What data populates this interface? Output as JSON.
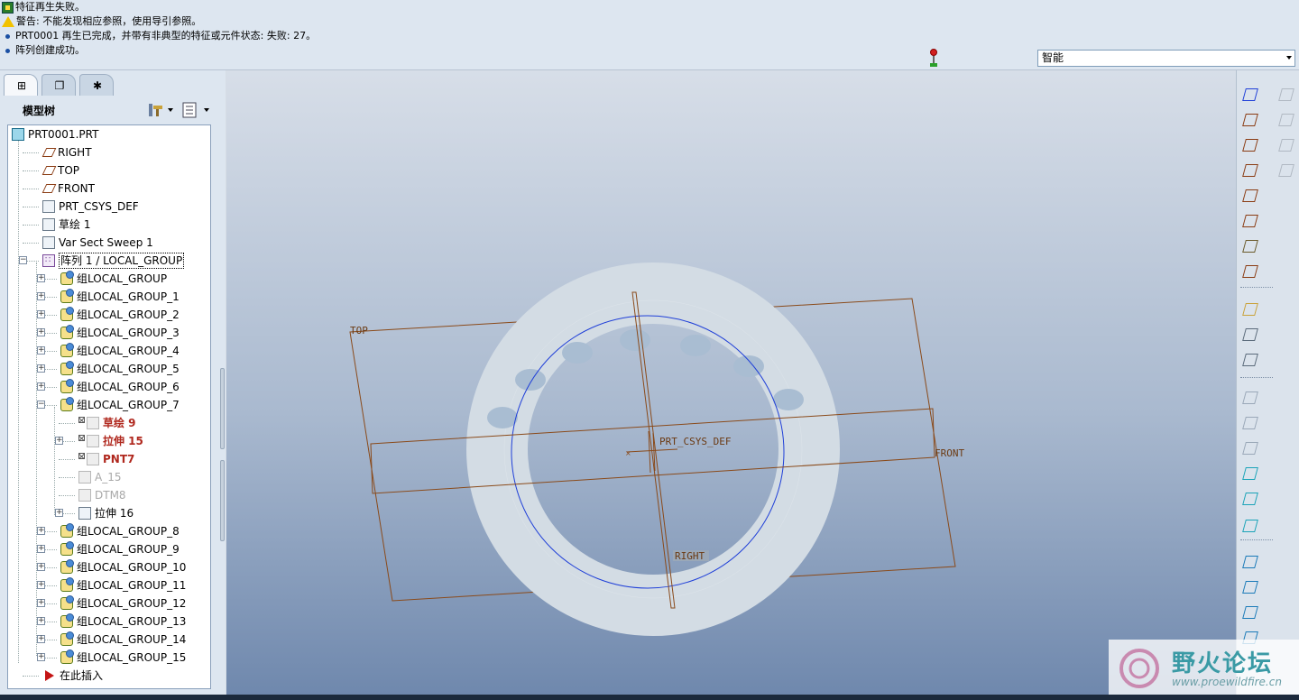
{
  "messages": [
    {
      "icon": "regen-fail-icon",
      "text": "特征再生失败。"
    },
    {
      "icon": "warning-icon",
      "text": "警告: 不能发现相应参照，使用导引参照。"
    },
    {
      "icon": "bullet-icon",
      "text": "PRT0001 再生已完成，并带有非典型的特征或元件状态: 失败: 27。"
    },
    {
      "icon": "bullet-icon",
      "text": "阵列创建成功。"
    }
  ],
  "filter": {
    "selected": "智能"
  },
  "navigator": {
    "tabs": [
      "model-tree-tab",
      "folder-browser-tab",
      "favorites-tab"
    ],
    "title": "模型树"
  },
  "tree": [
    {
      "label": "PRT0001.PRT",
      "icon": "part-icon",
      "level": 0,
      "state": "normal"
    },
    {
      "label": "RIGHT",
      "icon": "datum-plane-icon",
      "level": 1,
      "state": "normal"
    },
    {
      "label": "TOP",
      "icon": "datum-plane-icon",
      "level": 1,
      "state": "normal"
    },
    {
      "label": "FRONT",
      "icon": "datum-plane-icon",
      "level": 1,
      "state": "normal"
    },
    {
      "label": "PRT_CSYS_DEF",
      "icon": "csys-icon",
      "level": 1,
      "state": "normal"
    },
    {
      "label": "草绘 1",
      "icon": "sketch-icon",
      "level": 1,
      "state": "normal"
    },
    {
      "label": "Var Sect Sweep 1",
      "icon": "sweep-icon",
      "level": 1,
      "state": "normal"
    },
    {
      "label": "阵列 1 / LOCAL_GROUP",
      "icon": "pattern-icon",
      "level": 1,
      "state": "selected",
      "expander": "minus"
    },
    {
      "label": "组LOCAL_GROUP",
      "icon": "group-icon",
      "level": 2,
      "state": "normal",
      "expander": "plus"
    },
    {
      "label": "组LOCAL_GROUP_1",
      "icon": "group-icon",
      "level": 2,
      "state": "normal",
      "expander": "plus"
    },
    {
      "label": "组LOCAL_GROUP_2",
      "icon": "group-icon",
      "level": 2,
      "state": "normal",
      "expander": "plus"
    },
    {
      "label": "组LOCAL_GROUP_3",
      "icon": "group-icon",
      "level": 2,
      "state": "normal",
      "expander": "plus"
    },
    {
      "label": "组LOCAL_GROUP_4",
      "icon": "group-icon",
      "level": 2,
      "state": "normal",
      "expander": "plus"
    },
    {
      "label": "组LOCAL_GROUP_5",
      "icon": "group-icon",
      "level": 2,
      "state": "normal",
      "expander": "plus"
    },
    {
      "label": "组LOCAL_GROUP_6",
      "icon": "group-icon",
      "level": 2,
      "state": "normal",
      "expander": "plus"
    },
    {
      "label": "组LOCAL_GROUP_7",
      "icon": "group-icon",
      "level": 2,
      "state": "normal",
      "expander": "minus"
    },
    {
      "label": "草绘 9",
      "icon": "sketch-icon",
      "level": 3,
      "state": "failed"
    },
    {
      "label": "拉伸 15",
      "icon": "extrude-icon",
      "level": 3,
      "state": "failed",
      "expander": "plus"
    },
    {
      "label": "PNT7",
      "icon": "point-icon",
      "level": 3,
      "state": "failed"
    },
    {
      "label": "A_15",
      "icon": "axis-icon",
      "level": 3,
      "state": "dim"
    },
    {
      "label": "DTM8",
      "icon": "datum-plane-icon",
      "level": 3,
      "state": "dim"
    },
    {
      "label": "拉伸 16",
      "icon": "extrude-icon",
      "level": 3,
      "state": "normal",
      "expander": "plus"
    },
    {
      "label": "组LOCAL_GROUP_8",
      "icon": "group-icon",
      "level": 2,
      "state": "normal",
      "expander": "plus"
    },
    {
      "label": "组LOCAL_GROUP_9",
      "icon": "group-icon",
      "level": 2,
      "state": "normal",
      "expander": "plus"
    },
    {
      "label": "组LOCAL_GROUP_10",
      "icon": "group-icon",
      "level": 2,
      "state": "normal",
      "expander": "plus"
    },
    {
      "label": "组LOCAL_GROUP_11",
      "icon": "group-icon",
      "level": 2,
      "state": "normal",
      "expander": "plus"
    },
    {
      "label": "组LOCAL_GROUP_12",
      "icon": "group-icon",
      "level": 2,
      "state": "normal",
      "expander": "plus"
    },
    {
      "label": "组LOCAL_GROUP_13",
      "icon": "group-icon",
      "level": 2,
      "state": "normal",
      "expander": "plus"
    },
    {
      "label": "组LOCAL_GROUP_14",
      "icon": "group-icon",
      "level": 2,
      "state": "normal",
      "expander": "plus"
    },
    {
      "label": "组LOCAL_GROUP_15",
      "icon": "group-icon",
      "level": 2,
      "state": "normal",
      "expander": "plus"
    },
    {
      "label": "在此插入",
      "icon": "insert-here-icon",
      "level": 1,
      "state": "normal"
    }
  ],
  "graphics": {
    "datum_labels": {
      "top": "TOP",
      "front": "FRONT",
      "right": "RIGHT",
      "csys": "PRT_CSYS_DEF"
    },
    "colors": {
      "datum": "#8a4a1a",
      "ring": "#d3dce4",
      "sketch": "#1f3fd8",
      "hole": "#a9bdd2"
    }
  },
  "right_toolbar": [
    "sketch-tool-icon",
    "datum-plane-tool-icon",
    "datum-axis-tool-icon",
    "datum-curve-tool-icon",
    "datum-point-tool-icon",
    "csys-tool-icon",
    "analysis-datum-icon",
    "offset-point-icon",
    "sketch-region-icon",
    "datum-graph-icon",
    "copy-sketch-icon",
    "hole-tool-icon",
    "shell-tool-icon",
    "rib-tool-icon",
    "draft-tool-icon",
    "round-tool-icon",
    "chamfer-tool-icon",
    "extrude-tool-icon",
    "revolve-tool-icon",
    "sweep-tool-icon",
    "blend-tool-icon",
    "mirror-tool-icon",
    "pattern-tool-icon",
    "trim-tool-icon",
    "merge-tool-icon"
  ],
  "watermark": {
    "title": "野火论坛",
    "url": "www.proewildfire.cn"
  }
}
